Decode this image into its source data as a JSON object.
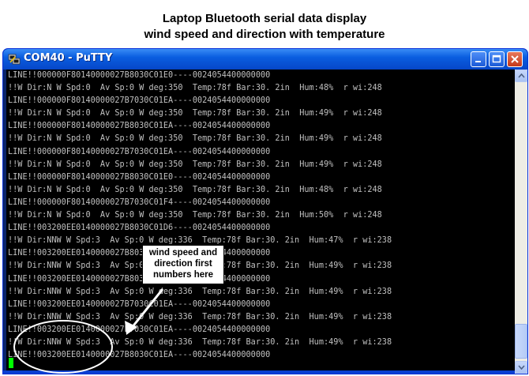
{
  "caption": {
    "line1": "Laptop Bluetooth serial data display",
    "line2": "wind speed and direction with temperature"
  },
  "window": {
    "title": "COM40 - PuTTY",
    "icon": "putty-icon",
    "buttons": [
      "minimize-icon",
      "maximize-icon",
      "close-icon"
    ],
    "titlebar_color": "#0a5ee0",
    "close_color": "#c4381a"
  },
  "terminal": {
    "text_color": "#c0c0c0",
    "cursor_color": "#00ff00",
    "lines": [
      "LINE!!000000F80140000027B8030C01E0----0024054400000000",
      "!!W Dir:N W Spd:0  Av Sp:0 W deg:350  Temp:78f Bar:30. 2in  Hum:48%  r wi:248",
      "LINE!!000000F80140000027B7030C01EA----0024054400000000",
      "!!W Dir:N W Spd:0  Av Sp:0 W deg:350  Temp:78f Bar:30. 2in  Hum:49%  r wi:248",
      "LINE!!000000F80140000027B8030C01EA----0024054400000000",
      "!!W Dir:N W Spd:0  Av Sp:0 W deg:350  Temp:78f Bar:30. 2in  Hum:49%  r wi:248",
      "LINE!!000000F80140000027B7030C01EA----0024054400000000",
      "!!W Dir:N W Spd:0  Av Sp:0 W deg:350  Temp:78f Bar:30. 2in  Hum:49%  r wi:248",
      "LINE!!000000F80140000027B8030C01E0----0024054400000000",
      "!!W Dir:N W Spd:0  Av Sp:0 W deg:350  Temp:78f Bar:30. 2in  Hum:48%  r wi:248",
      "LINE!!000000F80140000027B7030C01F4----0024054400000000",
      "!!W Dir:N W Spd:0  Av Sp:0 W deg:350  Temp:78f Bar:30. 2in  Hum:50%  r wi:248",
      "LINE!!003200EE0140000027B8030C01D6----0024054400000000",
      "!!W Dir:NNW W Spd:3  Av Sp:0 W deg:336  Temp:78f Bar:30. 2in  Hum:47%  r wi:238",
      "LINE!!003200EE0140000027B8030C01EA----0024054400000000",
      "!!W Dir:NNW W Spd:3  Av Sp:0 W deg:336  Temp:78f Bar:30. 2in  Hum:49%  r wi:238",
      "LINE!!003200EE0140000027B8030C01EA----0024054400000000",
      "!!W Dir:NNW W Spd:3  Av Sp:0 W deg:336  Temp:78f Bar:30. 2in  Hum:49%  r wi:238",
      "LINE!!003200EE0140000027B7030C01EA----0024054400000000",
      "!!W Dir:NNW W Spd:3  Av Sp:0 W deg:336  Temp:78f Bar:30. 2in  Hum:49%  r wi:238",
      "LINE!!003200EE0140000027B7030C01EA----0024054400000000",
      "!!W Dir:NNW W Spd:3  Av Sp:0 W deg:336  Temp:78f Bar:30. 2in  Hum:49%  r wi:238",
      "LINE!!003200EE0140000027B8030C01EA----0024054400000000"
    ]
  },
  "annotation": {
    "callout_text_1": "wind speed and",
    "callout_text_2": "direction first",
    "callout_text_3": "numbers here",
    "highlight_color": "#ffffff"
  },
  "scrollbar": {
    "up_icon": "scroll-up-icon",
    "down_icon": "scroll-down-icon",
    "thumb": "scroll-thumb"
  }
}
